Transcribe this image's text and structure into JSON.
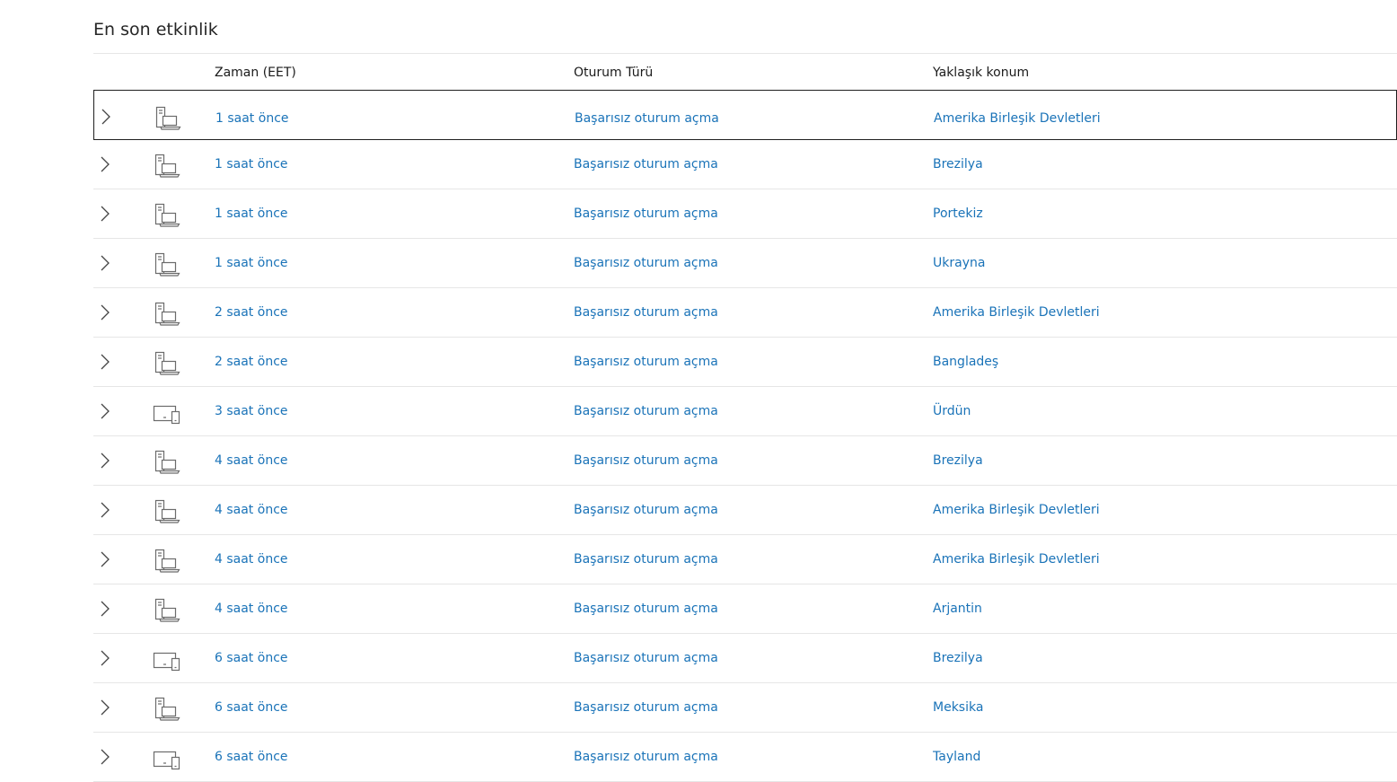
{
  "section": {
    "title": "En son etkinlik"
  },
  "table": {
    "headers": {
      "time": "Zaman (EET)",
      "type": "Oturum Türü",
      "location": "Yaklaşık konum"
    },
    "rows": [
      {
        "device": "desktop-laptop-icon",
        "time": "1 saat önce",
        "type": "Başarısız oturum açma",
        "location": "Amerika Birleşik Devletleri",
        "selected": true
      },
      {
        "device": "desktop-laptop-icon",
        "time": "1 saat önce",
        "type": "Başarısız oturum açma",
        "location": "Brezilya"
      },
      {
        "device": "desktop-laptop-icon",
        "time": "1 saat önce",
        "type": "Başarısız oturum açma",
        "location": "Portekiz"
      },
      {
        "device": "desktop-laptop-icon",
        "time": "1 saat önce",
        "type": "Başarısız oturum açma",
        "location": "Ukrayna"
      },
      {
        "device": "desktop-laptop-icon",
        "time": "2 saat önce",
        "type": "Başarısız oturum açma",
        "location": "Amerika Birleşik Devletleri"
      },
      {
        "device": "desktop-laptop-icon",
        "time": "2 saat önce",
        "type": "Başarısız oturum açma",
        "location": "Bangladeş"
      },
      {
        "device": "tablet-phone-icon",
        "time": "3 saat önce",
        "type": "Başarısız oturum açma",
        "location": "Ürdün"
      },
      {
        "device": "desktop-laptop-icon",
        "time": "4 saat önce",
        "type": "Başarısız oturum açma",
        "location": "Brezilya"
      },
      {
        "device": "desktop-laptop-icon",
        "time": "4 saat önce",
        "type": "Başarısız oturum açma",
        "location": "Amerika Birleşik Devletleri"
      },
      {
        "device": "desktop-laptop-icon",
        "time": "4 saat önce",
        "type": "Başarısız oturum açma",
        "location": "Amerika Birleşik Devletleri"
      },
      {
        "device": "desktop-laptop-icon",
        "time": "4 saat önce",
        "type": "Başarısız oturum açma",
        "location": "Arjantin"
      },
      {
        "device": "tablet-phone-icon",
        "time": "6 saat önce",
        "type": "Başarısız oturum açma",
        "location": "Brezilya"
      },
      {
        "device": "desktop-laptop-icon",
        "time": "6 saat önce",
        "type": "Başarısız oturum açma",
        "location": "Meksika"
      },
      {
        "device": "tablet-phone-icon",
        "time": "6 saat önce",
        "type": "Başarısız oturum açma",
        "location": "Tayland"
      }
    ]
  },
  "colors": {
    "link": "#1a73b8",
    "divider": "#e6e6e6",
    "icon": "#6b6b6b"
  }
}
